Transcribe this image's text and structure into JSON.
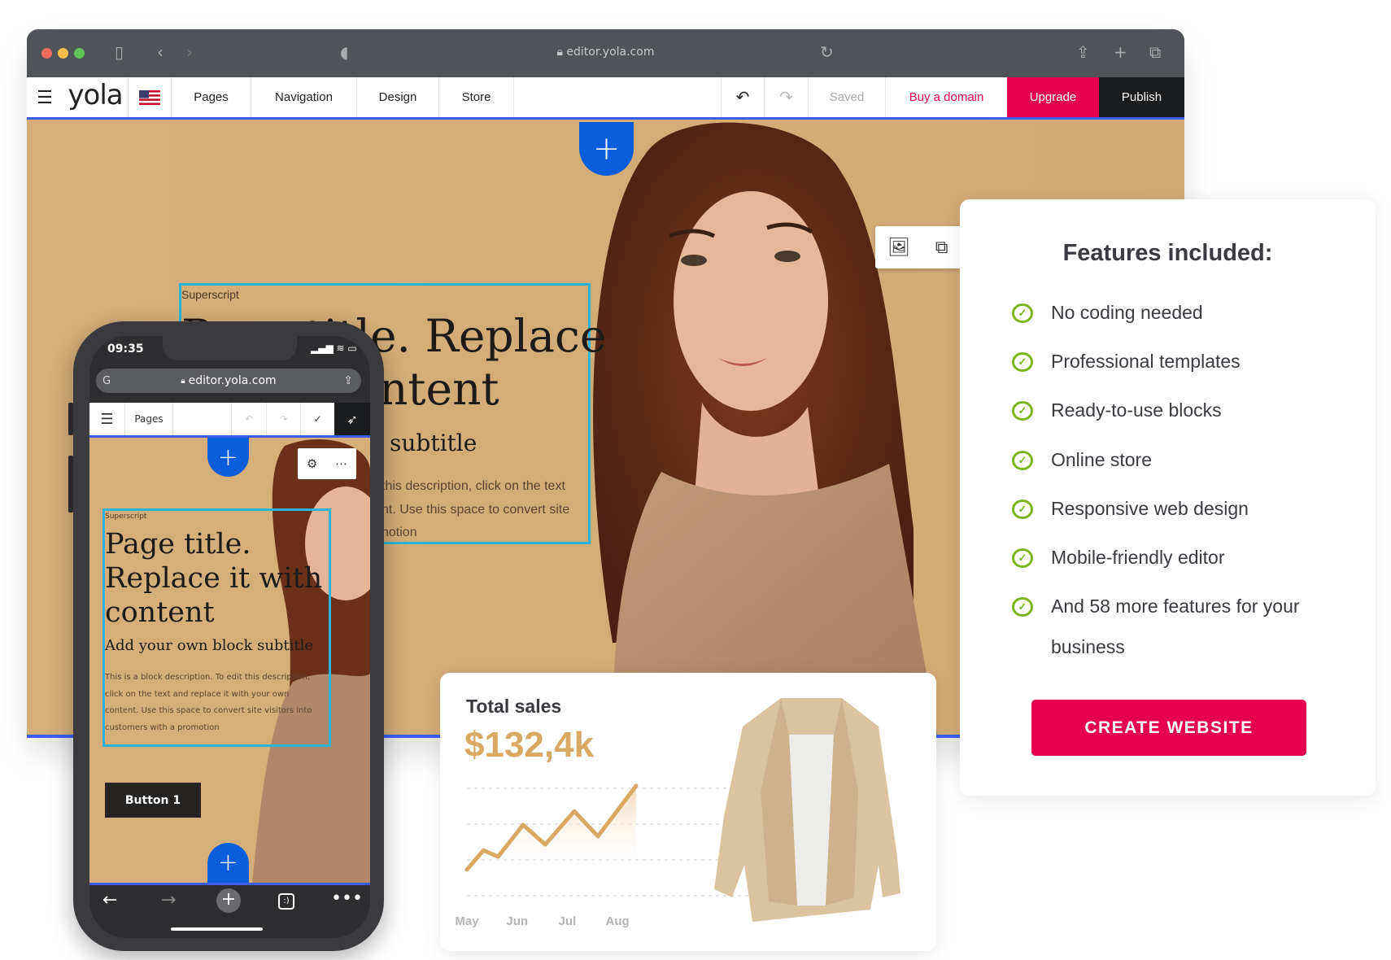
{
  "browser": {
    "url": "editor.yola.com",
    "logo": "yola",
    "nav": [
      "Pages",
      "Navigation",
      "Design",
      "Store"
    ],
    "saved": "Saved",
    "buy_domain": "Buy a domain",
    "upgrade": "Upgrade",
    "publish": "Publish",
    "colors": {
      "accent": "#e6004e",
      "publish": "#1b1c1e",
      "blue": "#0a5ddb"
    }
  },
  "hero": {
    "superscript": "Superscript",
    "title_line1": "Page title. Replace",
    "title_line2": "ntent",
    "subtitle": "subtitle",
    "desc": [
      "this description, click on the text",
      "nt. Use this space to convert site",
      "notion"
    ]
  },
  "features": {
    "title": "Features included:",
    "items": [
      "No coding needed",
      "Professional templates",
      "Ready-to-use blocks",
      "Online store",
      "Responsive web design",
      "Mobile-friendly editor",
      "And 58 more features for your",
      "business"
    ],
    "cta": "CREATE WEBSITE"
  },
  "sales": {
    "title": "Total sales",
    "value": "$132,4k"
  },
  "chart_data": {
    "type": "area",
    "categories": [
      "May",
      "Jun",
      "Jul",
      "Aug"
    ],
    "x": [
      -0.18,
      0.15,
      0.44,
      0.94,
      1.38,
      1.96,
      2.43,
      3.19
    ],
    "y": [
      0.73,
      1.27,
      1.09,
      1.98,
      1.43,
      2.36,
      1.66,
      3.07
    ],
    "ylim": [
      0,
      3
    ],
    "grid": true,
    "color": "#d9a862"
  },
  "phone": {
    "time": "09:35",
    "url": "editor.yola.com",
    "pages": "Pages",
    "superscript": "Superscript",
    "title": [
      "Page title.",
      "Replace it with",
      "content"
    ],
    "subtitle": "Add your own block subtitle",
    "desc": [
      "This is a block description. To edit this description,",
      "click on the text and replace it with your own",
      "content. Use this space to convert site visitors into",
      "customers with a promotion"
    ],
    "button": "Button 1"
  }
}
